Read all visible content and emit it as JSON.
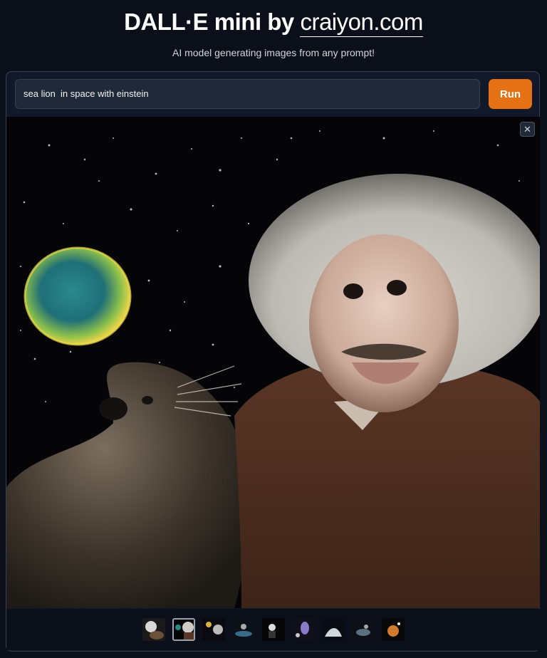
{
  "header": {
    "title_prefix": "DALL·E mini by",
    "title_link": "craiyon.com",
    "subtitle": "AI model generating images from any prompt!"
  },
  "prompt": {
    "value": "sea lion  in space with einstein"
  },
  "run_button": {
    "label": "Run"
  },
  "close_button": {
    "label": "✕"
  },
  "gallery": {
    "selected_index": 1,
    "thumbnail_count": 9
  },
  "colors": {
    "background": "#0b0f19",
    "panel": "#111827",
    "accent": "#e57114"
  }
}
